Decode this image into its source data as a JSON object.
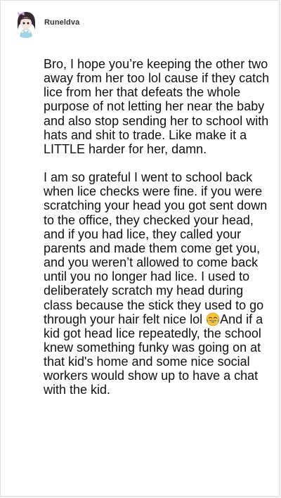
{
  "post": {
    "author": {
      "username": "Runeldva"
    },
    "paragraphs": [
      "Bro, I hope you’re keeping the other two away from her too lol cause if they catch lice from her that defeats the whole purpose of not letting her near the baby and also stop sending her to school with hats and shit to trade. Like make it a LITTLE harder for her, damn."
    ],
    "paragraph2_before_emoji": "I am so grateful I went to school back when lice checks were fine. if you were scratching your head you got sent down to the office, they checked your head, and if you had lice, they called your parents and made them come get you, and you weren’t allowed to come back until you no longer had lice. I used to deliberately scratch my head during class because the stick they used to go through your hair felt nice lol ",
    "emoji_icon": "face-with-tears-of-joy-icon",
    "paragraph2_after_emoji": "And if a kid got head lice repeatedly, the school knew something funky was going on at that kid's home and some nice social workers would show up to have a chat with the kid."
  },
  "colors": {
    "card_background": "#ffffff",
    "page_background": "#f2f2f2",
    "text": "#111111",
    "username": "#333333"
  }
}
